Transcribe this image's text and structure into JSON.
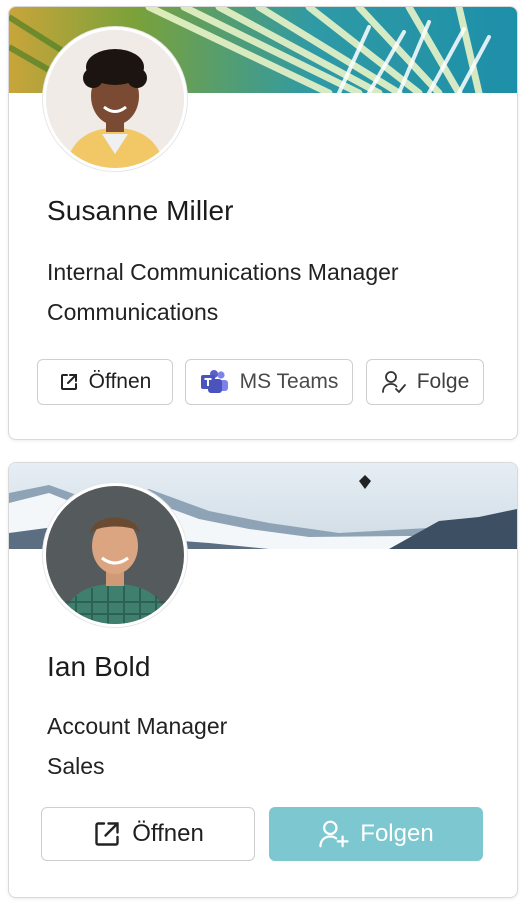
{
  "profiles": [
    {
      "name": "Susanne Miller",
      "title": "Internal Communications Manager",
      "department": "Communications",
      "actions": {
        "open_label": "Öffnen",
        "teams_label": "MS Teams",
        "follow_label": "Folge"
      }
    },
    {
      "name": "Ian Bold",
      "title": "Account Manager",
      "department": "Sales",
      "actions": {
        "open_label": "Öffnen",
        "follow_label": "Folgen"
      }
    }
  ],
  "colors": {
    "follow_primary": "#7cc7d0",
    "teams_purple": "#5b5fc7",
    "card_border": "#d9d9d9"
  },
  "icons": {
    "open": "external-link-icon",
    "teams": "ms-teams-icon",
    "follow": "person-check-icon",
    "follow_add": "person-add-icon"
  }
}
